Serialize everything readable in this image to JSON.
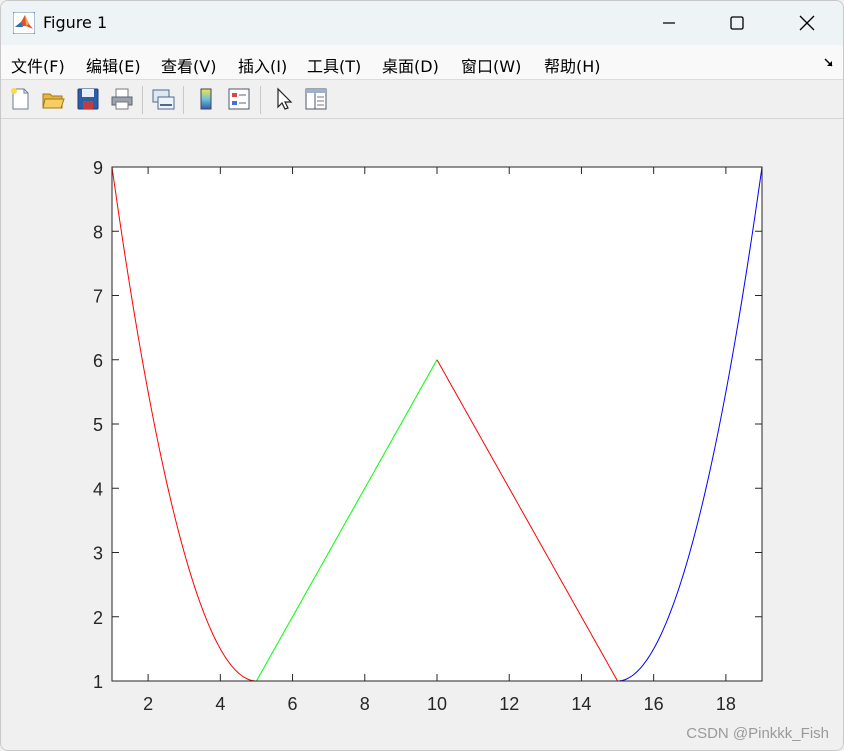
{
  "window": {
    "title": "Figure 1"
  },
  "menu": {
    "items": [
      {
        "label": "文件(F)"
      },
      {
        "label": "编辑(E)"
      },
      {
        "label": "查看(V)"
      },
      {
        "label": "插入(I)"
      },
      {
        "label": "工具(T)"
      },
      {
        "label": "桌面(D)"
      },
      {
        "label": "窗口(W)"
      },
      {
        "label": "帮助(H)"
      }
    ]
  },
  "toolbar": {
    "icons": [
      "new-figure-icon",
      "open-file-icon",
      "save-icon",
      "print-icon",
      "link-plot-icon",
      "colorbar-icon",
      "legend-icon",
      "pointer-icon",
      "property-inspector-icon"
    ]
  },
  "watermark": "CSDN @Pinkkk_Fish",
  "chart_data": {
    "type": "line",
    "xlim": [
      1,
      19
    ],
    "ylim": [
      1,
      9
    ],
    "xticks": [
      2,
      4,
      6,
      8,
      10,
      12,
      14,
      16,
      18
    ],
    "yticks": [
      1,
      2,
      3,
      4,
      5,
      6,
      7,
      8,
      9
    ],
    "grid": false,
    "series": [
      {
        "color": "#ff0000",
        "curve": "quadratic",
        "x": [
          1,
          5
        ],
        "y": [
          9,
          1
        ]
      },
      {
        "color": "#00ff00",
        "curve": "linear",
        "x": [
          5,
          10
        ],
        "y": [
          1,
          6
        ]
      },
      {
        "color": "#ff0000",
        "curve": "linear",
        "x": [
          10,
          15
        ],
        "y": [
          6,
          1
        ]
      },
      {
        "color": "#0000ff",
        "curve": "quadratic",
        "x": [
          15,
          19
        ],
        "y": [
          1,
          9
        ]
      }
    ]
  }
}
